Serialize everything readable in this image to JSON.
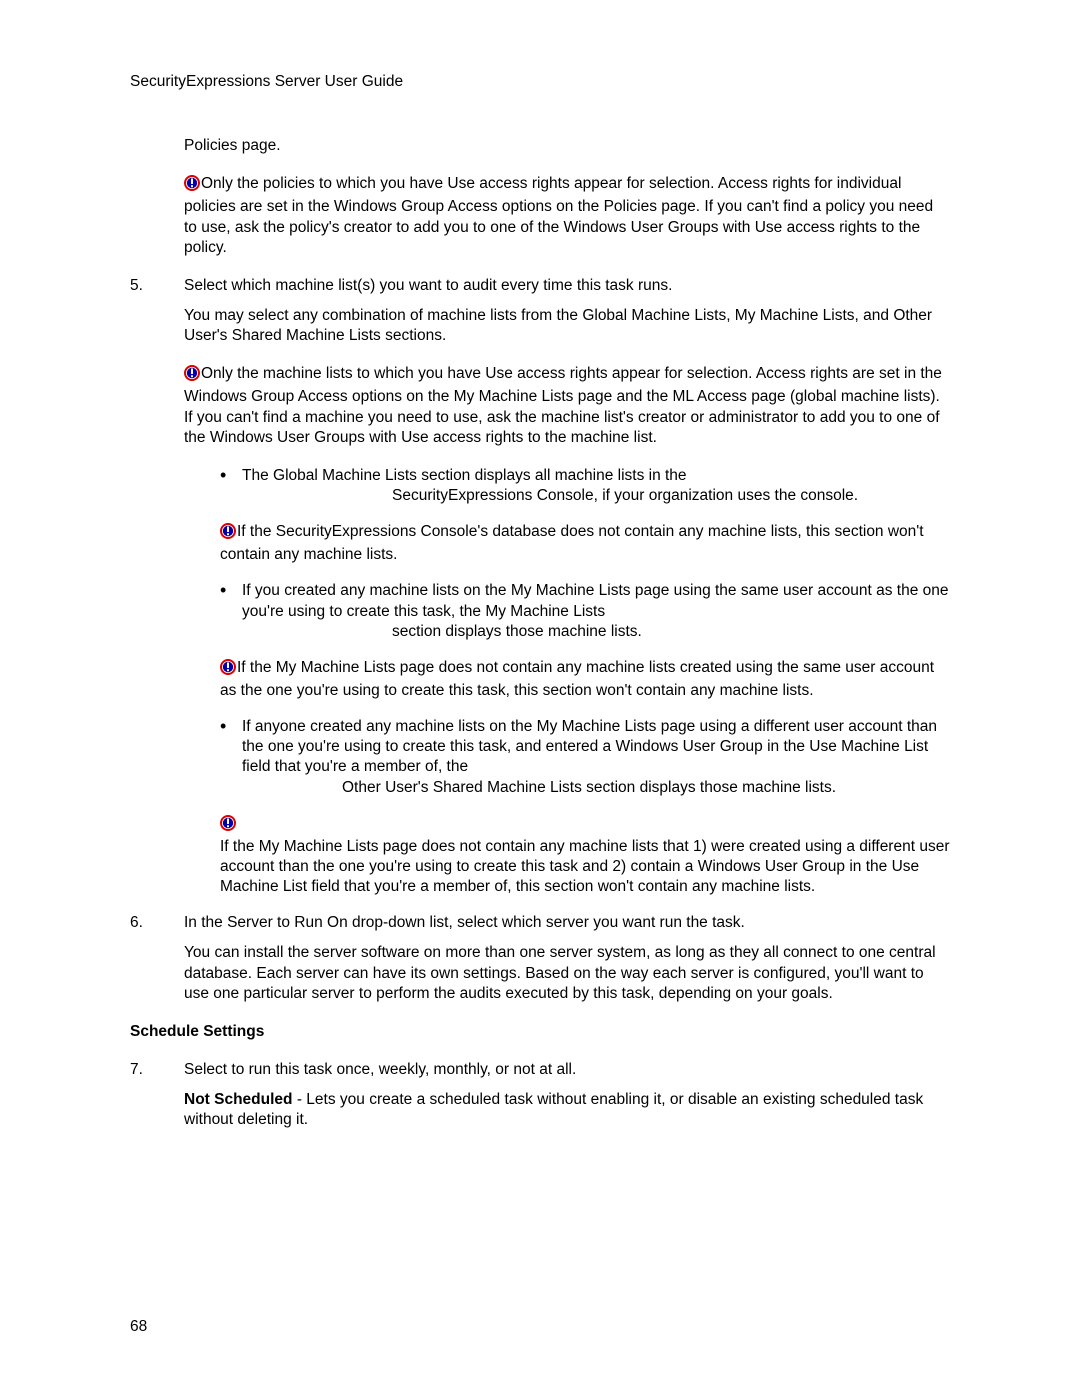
{
  "header": "SecurityExpressions Server User Guide",
  "p_policies_page": "Policies page.",
  "note1": "Only the policies to which you have Use access rights appear for selection. Access rights for individual policies are set in the Windows Group Access options on the Policies page. If you can't find a policy you need to use, ask the policy's creator to add you to one of the Windows User Groups with Use access rights to the policy.",
  "step5_num": "5.",
  "step5_text": "Select which machine list(s) you want to audit every time this task runs.",
  "step5_para": "You may select any combination of machine lists from the Global Machine Lists, My Machine Lists, and Other User's Shared Machine Lists sections.",
  "note2": "Only the machine lists to which you have Use access rights appear for selection. Access rights are set in the Windows Group Access options on the My Machine Lists page and the ML Access page (global machine lists). If you can't find a machine you need to use, ask the machine list's creator or administrator to add you to one of the Windows User Groups with Use access rights to the machine list.",
  "bullet1_a": "The Global Machine Lists section displays all machine lists in the",
  "bullet1_b": "SecurityExpressions Console, if your organization uses the console.",
  "subnote1": "If the SecurityExpressions Console's database does not contain any machine lists, this section won't contain any machine lists.",
  "bullet2_a": "If you created any machine lists on the My Machine Lists page using the same user account as the one you're using to create this task, the My Machine Lists",
  "bullet2_b": "section displays those machine lists.",
  "subnote2": "If the My Machine Lists page does not contain any machine lists created using the same user account as the one you're using to create this task, this section won't contain any machine lists.",
  "bullet3_a": "If anyone created any machine lists on the My Machine Lists page using a different user account than the one you're using to create this task, and entered a Windows User Group in the Use Machine List field that you're a member of, the",
  "bullet3_b": "Other User's Shared Machine Lists section displays those machine lists.",
  "subnote3": "If the My Machine Lists page does not contain any machine lists that 1) were created using a different user account than the one you're using to create this task and 2) contain a Windows User Group in the Use Machine List field that you're a member of, this section won't contain any machine lists.",
  "step6_num": "6.",
  "step6_text": "In the Server to Run On drop-down list, select which server you want run the task.",
  "step6_para": "You can install the server software on more than one server system, as long as they all connect to one central database. Each server can have its own settings. Based on the way each server is configured, you'll want to use one particular server to perform the audits executed by this task, depending on your goals.",
  "schedule_heading": "Schedule Settings",
  "step7_num": "7.",
  "step7_text": "Select to run this task once, weekly, monthly, or not at all.",
  "step7_para_label": "Not Scheduled",
  "step7_para_rest": " - Lets you create a scheduled task without enabling it, or disable an existing scheduled task without deleting it.",
  "page_number": "68"
}
